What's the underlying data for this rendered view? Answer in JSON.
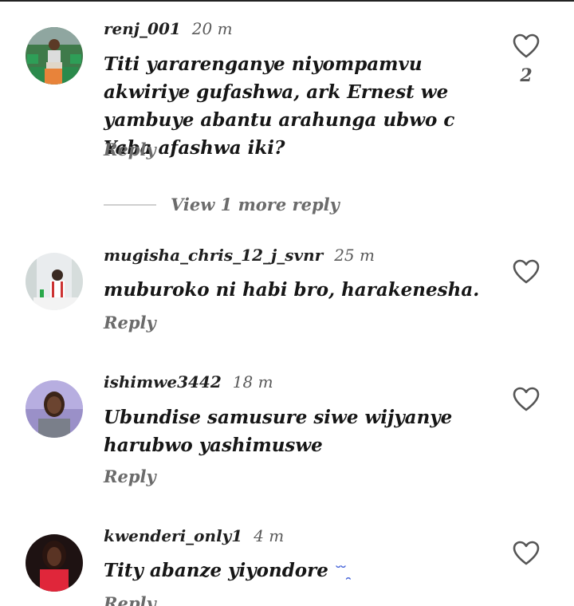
{
  "comments": [
    {
      "username": "renj_001",
      "time": "20 m",
      "text": "Titi yararenganye niyompamvu akwiriye gufashwa, ark Ernest we yambuye abantu arahunga ubwo c Yaba afashwa iki?",
      "reply_label": "Reply",
      "like_count": "2",
      "view_more": "View 1 more reply"
    },
    {
      "username": "mugisha_chris_12_j_svnr",
      "time": "25 m",
      "text": "muburoko ni habi bro, harakenesha.",
      "reply_label": "Reply"
    },
    {
      "username": "ishimwe3442",
      "time": "18 m",
      "text": "Ubundise samusure siwe wijyanye harubwo yashimuswe",
      "reply_label": "Reply"
    },
    {
      "username": "kwenderi_only1",
      "time": "4 m",
      "text": "Tity abanze yiyondore",
      "emoji": "˘ ̆ ̯",
      "reply_label": "Reply"
    }
  ],
  "icons": {
    "like": "heart-outline-icon"
  },
  "colors": {
    "text": "#161616",
    "muted": "#6b6b6b",
    "heart_stroke": "#555555"
  }
}
